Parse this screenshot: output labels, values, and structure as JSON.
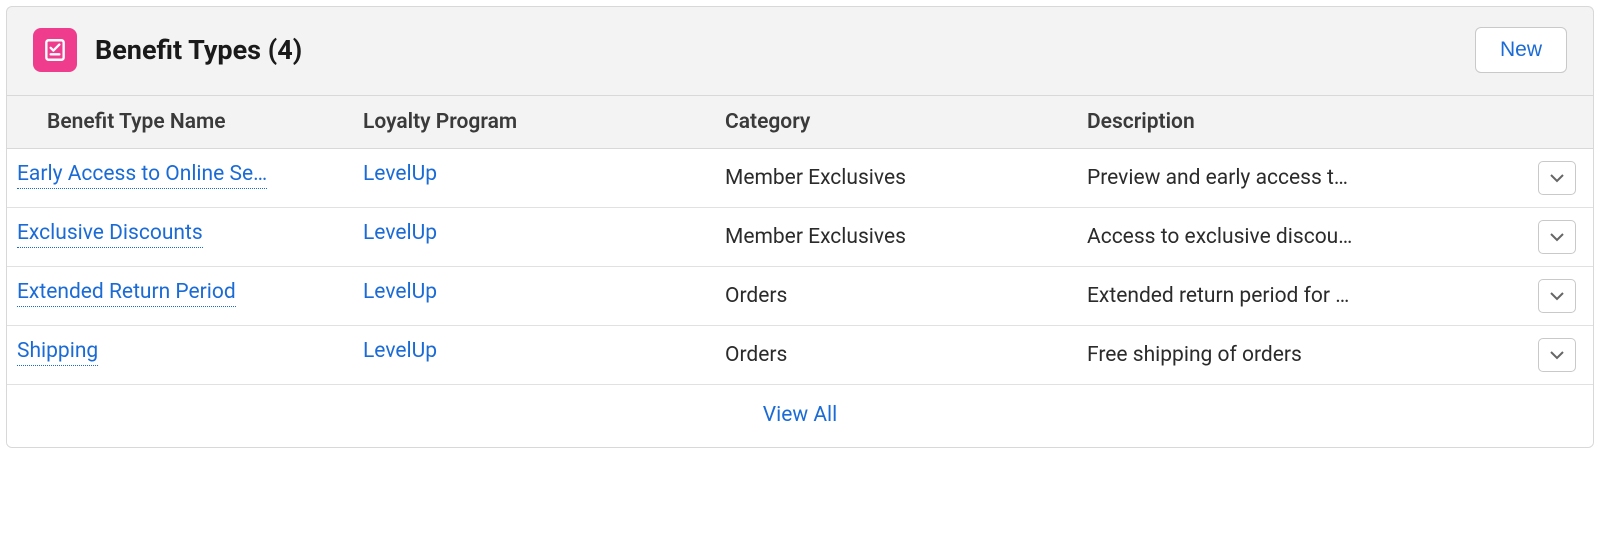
{
  "header": {
    "title": "Benefit Types (4)",
    "new_button": "New"
  },
  "columns": {
    "name": "Benefit Type Name",
    "program": "Loyalty Program",
    "category": "Category",
    "description": "Description"
  },
  "rows": [
    {
      "name": "Early Access to Online Se…",
      "program": "LevelUp",
      "category": "Member Exclusives",
      "description": "Preview and early access t…"
    },
    {
      "name": "Exclusive Discounts",
      "program": "LevelUp",
      "category": "Member Exclusives",
      "description": "Access to exclusive discou…"
    },
    {
      "name": "Extended Return Period",
      "program": "LevelUp",
      "category": "Orders",
      "description": "Extended return period for …"
    },
    {
      "name": "Shipping",
      "program": "LevelUp",
      "category": "Orders",
      "description": "Free shipping of orders"
    }
  ],
  "footer": {
    "view_all": "View All"
  }
}
